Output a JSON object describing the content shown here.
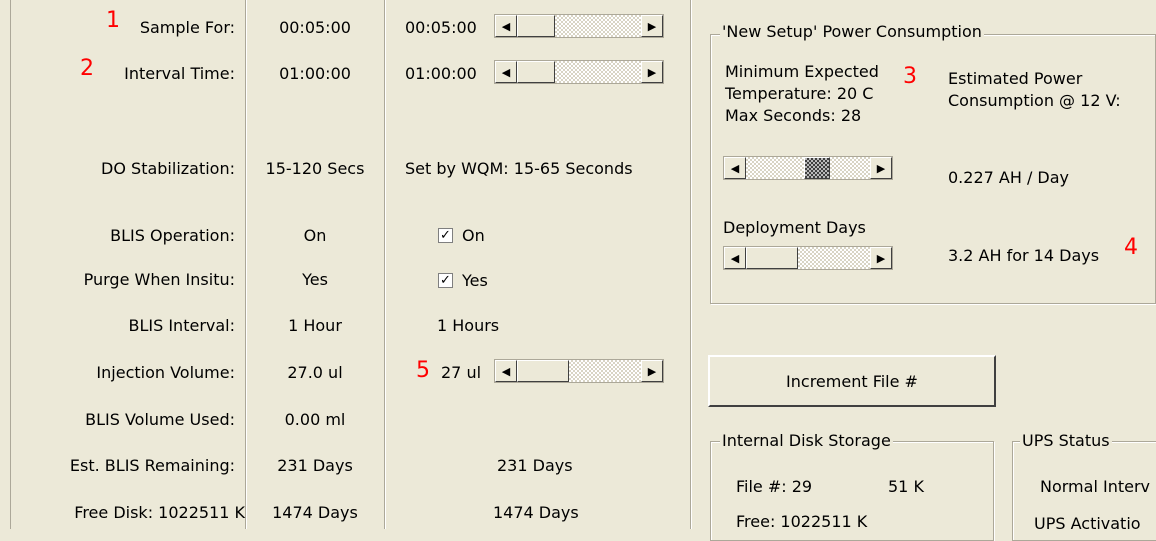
{
  "rows": [
    {
      "label": "Sample For:",
      "current": "00:05:00",
      "setting": "00:05:00"
    },
    {
      "label": "Interval Time:",
      "current": "01:00:00",
      "setting": "01:00:00"
    },
    {
      "label": "DO Stabilization:",
      "current": "15-120 Secs",
      "setting": "Set by WQM: 15-65 Seconds"
    },
    {
      "label": "BLIS Operation:",
      "current": "On",
      "setting": "On"
    },
    {
      "label": "Purge When Insitu:",
      "current": "Yes",
      "setting": "Yes"
    },
    {
      "label": "BLIS Interval:",
      "current": "1 Hour",
      "setting": "1 Hours"
    },
    {
      "label": "Injection Volume:",
      "current": "27.0 ul",
      "setting": "27 ul"
    },
    {
      "label": "BLIS Volume Used:",
      "current": "0.00 ml",
      "setting": ""
    },
    {
      "label": "Est. BLIS Remaining:",
      "current": "231 Days",
      "setting": "231 Days"
    },
    {
      "label": "Free Disk: 1022511 K",
      "current": "1474 Days",
      "setting": "1474 Days"
    }
  ],
  "callouts": [
    "1",
    "2",
    "3",
    "4",
    "5"
  ],
  "power": {
    "title": "'New Setup' Power Consumption",
    "min_expected": "Minimum Expected",
    "temperature": "Temperature: 20 C",
    "max_seconds": "Max Seconds: 28",
    "est_line1": "Estimated  Power",
    "est_line2": "Consumption @ 12 V:",
    "per_day": "0.227 AH / Day",
    "deployment_label": "Deployment Days",
    "total": "3.2 AH for 14 Days"
  },
  "increment_button": "Increment File #",
  "disk": {
    "title": "Internal Disk Storage",
    "file_label": "File #:  29",
    "file_size": "51 K",
    "free": "Free:  1022511 K"
  },
  "ups": {
    "title": "UPS Status",
    "line1": "Normal Interv",
    "line2": "UPS Activatio"
  },
  "colors": {
    "callout": "#ff0000",
    "background": "#ece9d8"
  },
  "scrollbars": {
    "sample_for_position": 0.0,
    "interval_position": 0.0,
    "temperature_position": 0.5,
    "deployment_position": 0.0,
    "injection_position": 0.0
  },
  "icons": {
    "left_arrow": "arrow-left-icon",
    "right_arrow": "arrow-right-icon",
    "check": "check-icon"
  }
}
